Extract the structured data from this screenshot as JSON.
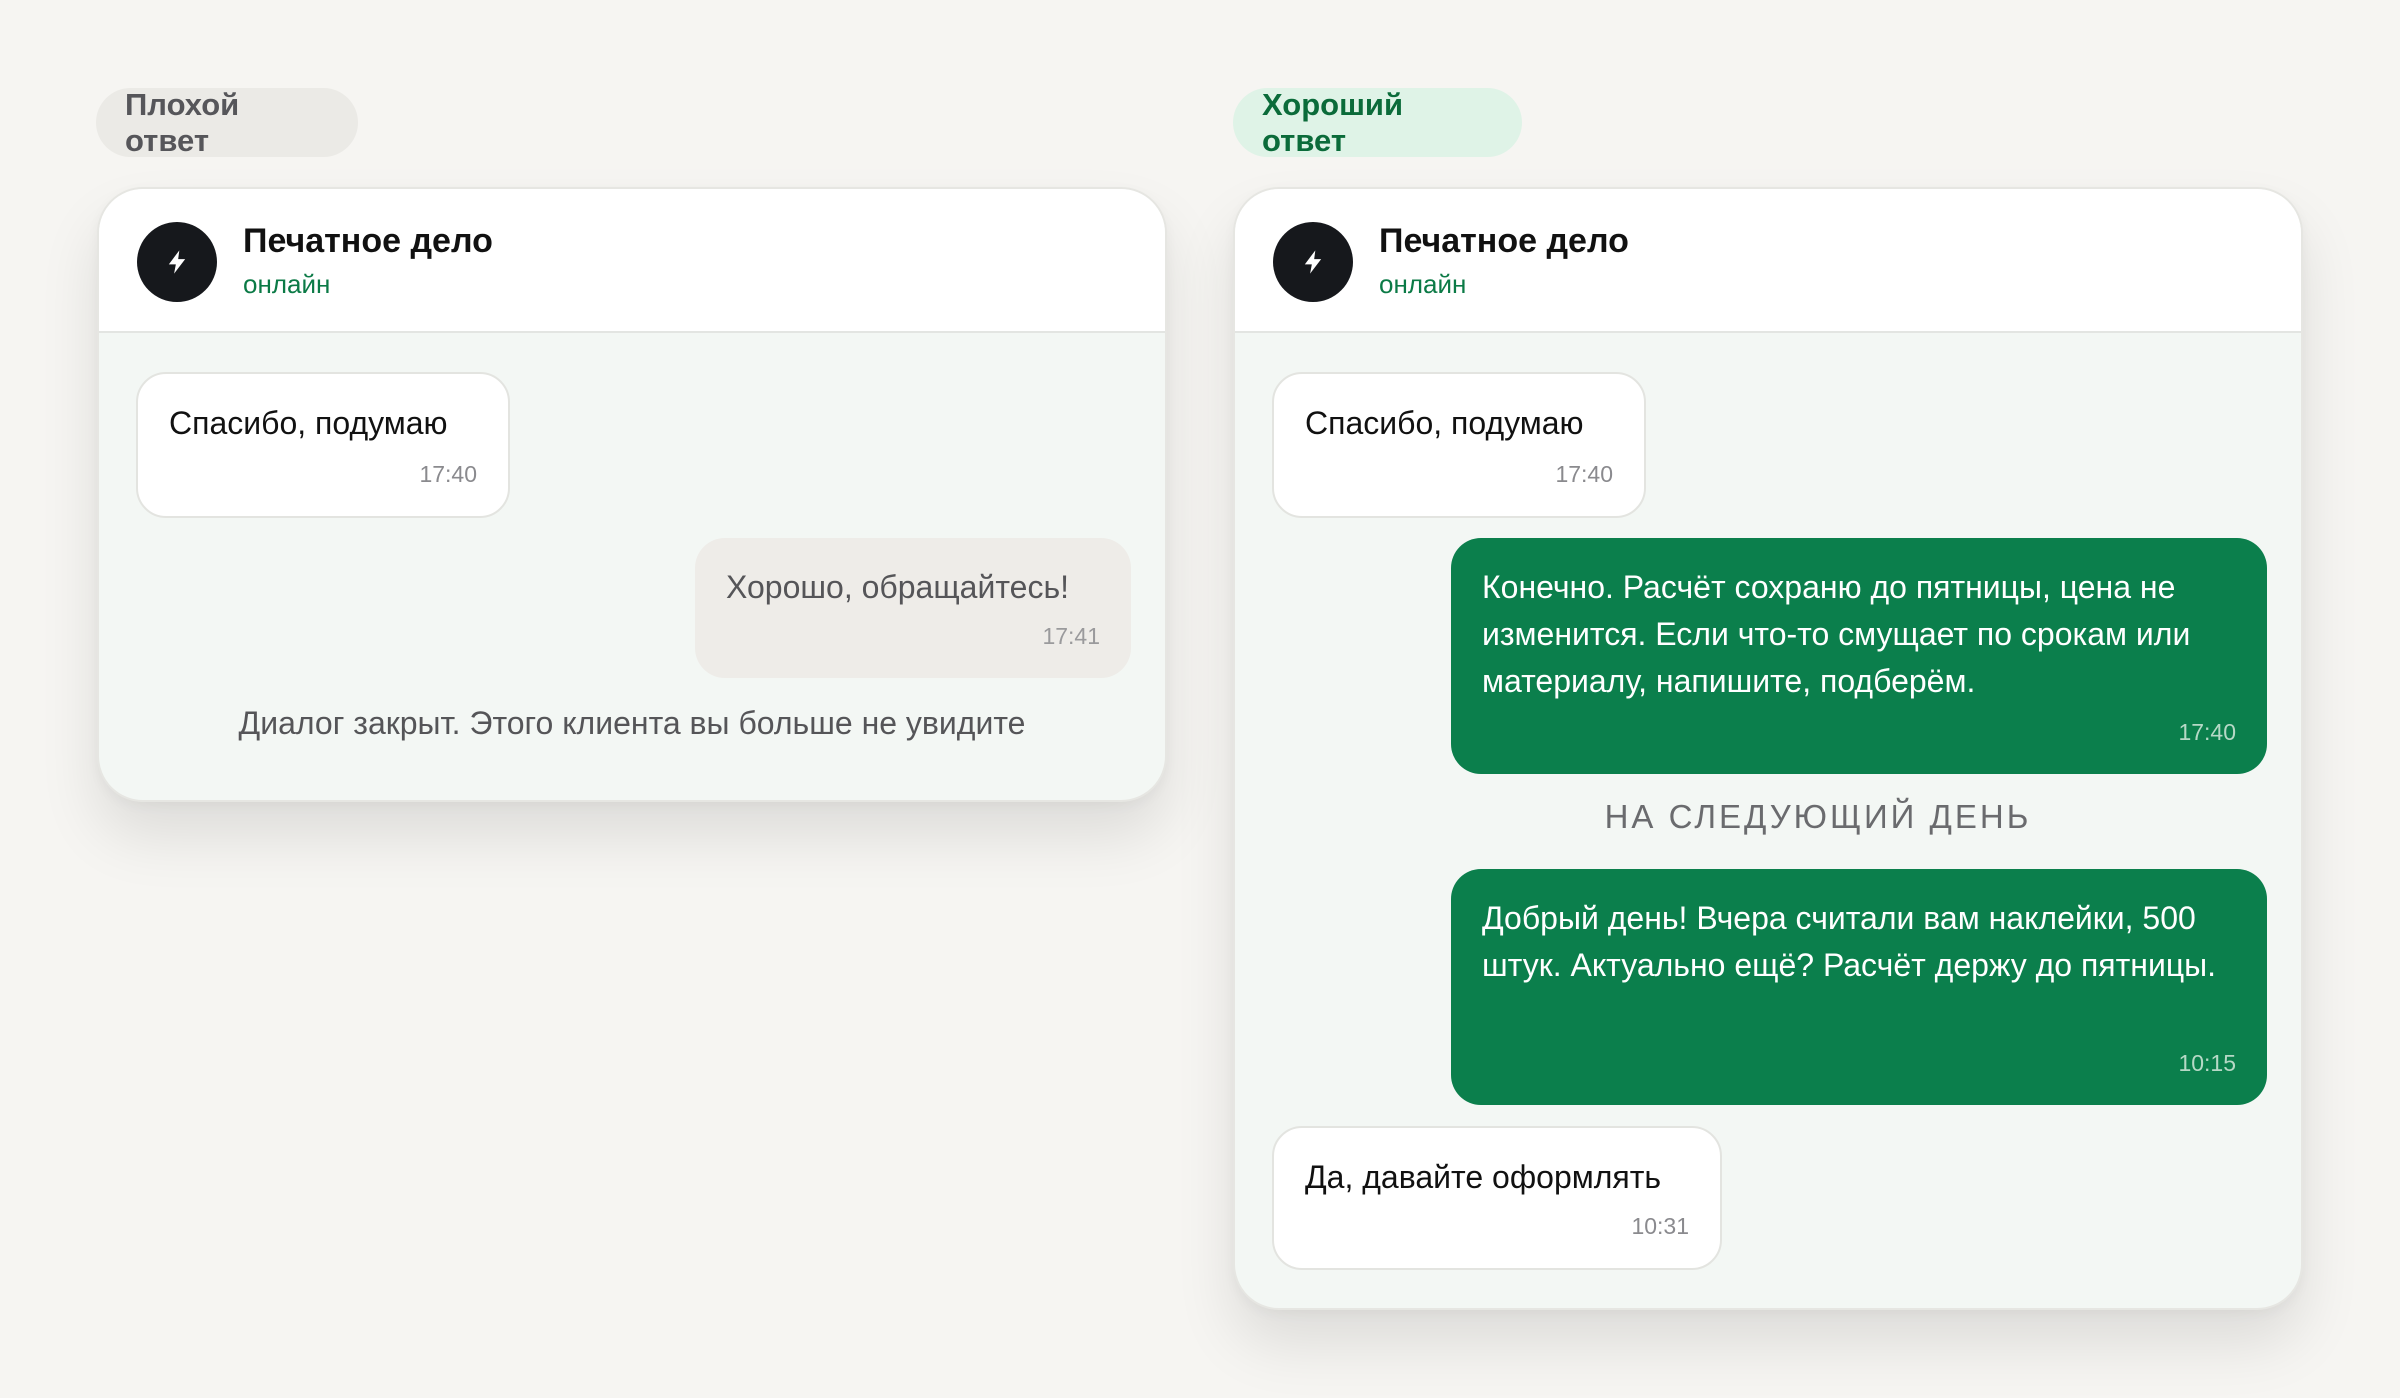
{
  "bad": {
    "label": "Плохой ответ",
    "header": {
      "title": "Печатное дело",
      "status": "онлайн"
    },
    "messages": [
      {
        "text": "Спасибо, подумаю",
        "time": "17:40"
      },
      {
        "text": "Хорошо, обращайтесь!",
        "time": "17:41"
      }
    ],
    "system_note": "Диалог закрыт. Этого клиента вы больше не увидите"
  },
  "good": {
    "label": "Хороший ответ",
    "header": {
      "title": "Печатное дело",
      "status": "онлайн"
    },
    "messages": [
      {
        "text": "Спасибо, подумаю",
        "time": "17:40"
      },
      {
        "text": "Конечно. Расчёт сохраню до пятницы, цена не изменится. Если что-то смущает по срокам или материалу, напишите, подберём.",
        "time": "17:40"
      },
      {
        "text": "Добрый день! Вчера считали вам наклейки, 500 штук. Актуально ещё? Расчёт держу до пятницы.",
        "time": "10:15"
      },
      {
        "text": "Да, давайте оформлять",
        "time": "10:31"
      }
    ],
    "day_separator": "НА СЛЕДУЮЩИЙ ДЕНЬ"
  },
  "icons": {
    "avatar": "lightning-icon"
  },
  "colors": {
    "background": "#f6f5f2",
    "accent_green": "#0b7f4c",
    "status_green": "#0b7a46",
    "good_pill_bg": "#dff3e7",
    "bad_pill_bg": "#ebeae6"
  }
}
